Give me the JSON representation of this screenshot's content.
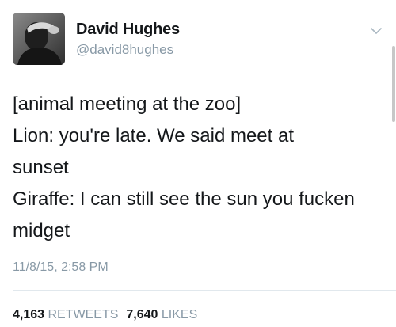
{
  "author": {
    "name": "David Hughes",
    "handle": "@david8hughes"
  },
  "tweet": {
    "lines": [
      "[animal meeting at the zoo]",
      "Lion: you're late. We said meet at",
      "sunset",
      "Giraffe: I can still see the sun you fucken",
      "midget"
    ],
    "timestamp": "11/8/15, 2:58 PM"
  },
  "stats": {
    "retweets_count": "4,163",
    "retweets_label": "RETWEETS",
    "likes_count": "7,640",
    "likes_label": "LIKES"
  },
  "icons": {
    "menu": "chevron-down-icon"
  },
  "colors": {
    "text": "#14171a",
    "secondary": "#8899a6",
    "divider": "#e1e8ed"
  }
}
